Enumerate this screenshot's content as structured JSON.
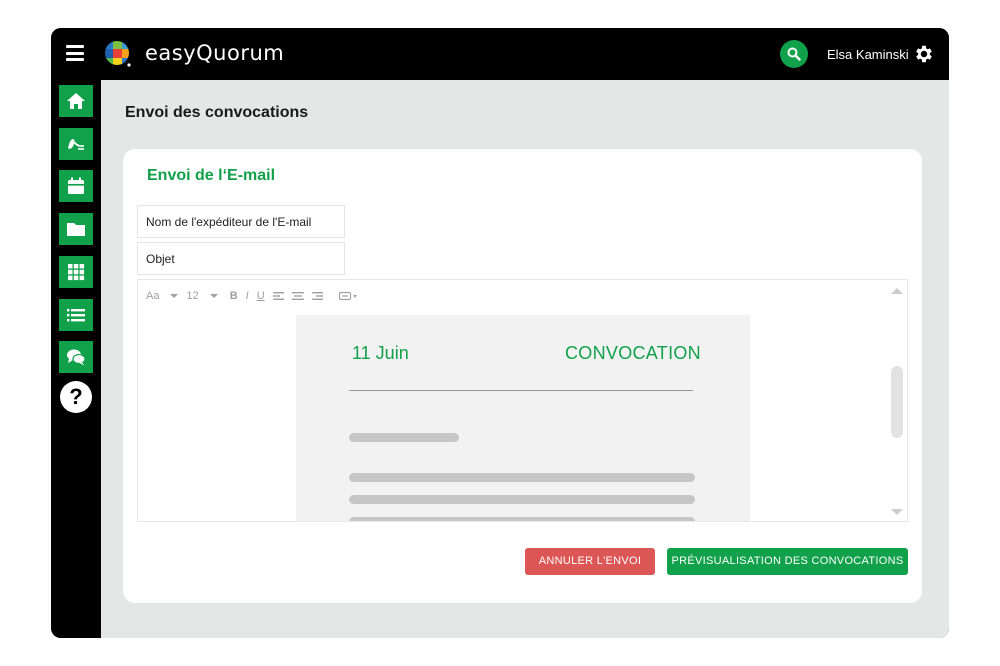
{
  "app": {
    "title": "easyQuorum",
    "user_name": "Elsa Kaminski"
  },
  "colors": {
    "brand_green": "#10a14a",
    "cancel_red": "#dc5656",
    "topbar_bg": "#000000",
    "content_bg": "#e5e7e6"
  },
  "sidebar": {
    "items": [
      {
        "icon": "home-icon"
      },
      {
        "icon": "signature-icon"
      },
      {
        "icon": "calendar-icon"
      },
      {
        "icon": "folder-icon"
      },
      {
        "icon": "grid-icon"
      },
      {
        "icon": "list-icon"
      },
      {
        "icon": "chat-icon"
      }
    ],
    "help_label": "?"
  },
  "page": {
    "title": "Envoi des convocations"
  },
  "email_form": {
    "title": "Envoi de l‘E-mail",
    "sender_placeholder": "Nom de l'expéditeur de l'E-mail",
    "subject_placeholder": "Objet"
  },
  "editor": {
    "toolbar": {
      "font_label": "Aa",
      "size_label": "12",
      "bold_label": "B",
      "italic_label": "I",
      "underline_label": "U"
    },
    "document": {
      "date": "11 Juin",
      "heading": "CONVOCATION"
    }
  },
  "actions": {
    "cancel_label": "ANNULER L'ENVOI",
    "preview_label": "PRÉVISUALISATION DES CONVOCATIONS"
  }
}
